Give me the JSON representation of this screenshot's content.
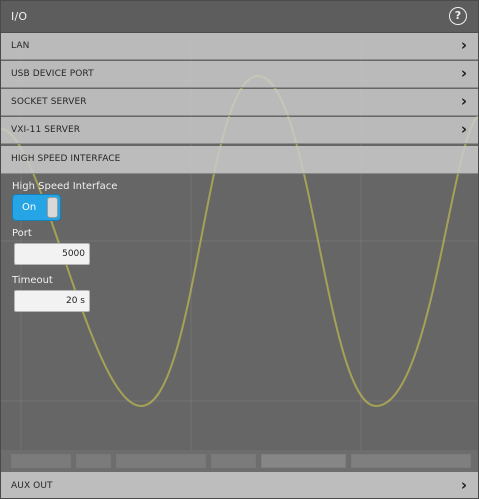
{
  "dialog": {
    "title": "I/O",
    "help_icon": "?"
  },
  "menu": {
    "items": [
      {
        "label": "LAN",
        "chevron": "›"
      },
      {
        "label": "USB DEVICE PORT",
        "chevron": "›"
      },
      {
        "label": "SOCKET SERVER",
        "chevron": "›"
      },
      {
        "label": "VXI-11 SERVER",
        "chevron": "›"
      }
    ]
  },
  "high_speed": {
    "section_title": "HIGH SPEED INTERFACE",
    "toggle_label": "High Speed Interface",
    "toggle_value": "On",
    "port_label": "Port",
    "port_value": "5000",
    "timeout_label": "Timeout",
    "timeout_value": "20 s"
  },
  "aux_out": {
    "label": "AUX OUT",
    "chevron": "›"
  },
  "colors": {
    "accent_toggle": "#25a4e6",
    "waveform": "#d8d24a"
  },
  "icons": {
    "help": "help-circle-icon",
    "chevron": "chevron-right-icon"
  }
}
